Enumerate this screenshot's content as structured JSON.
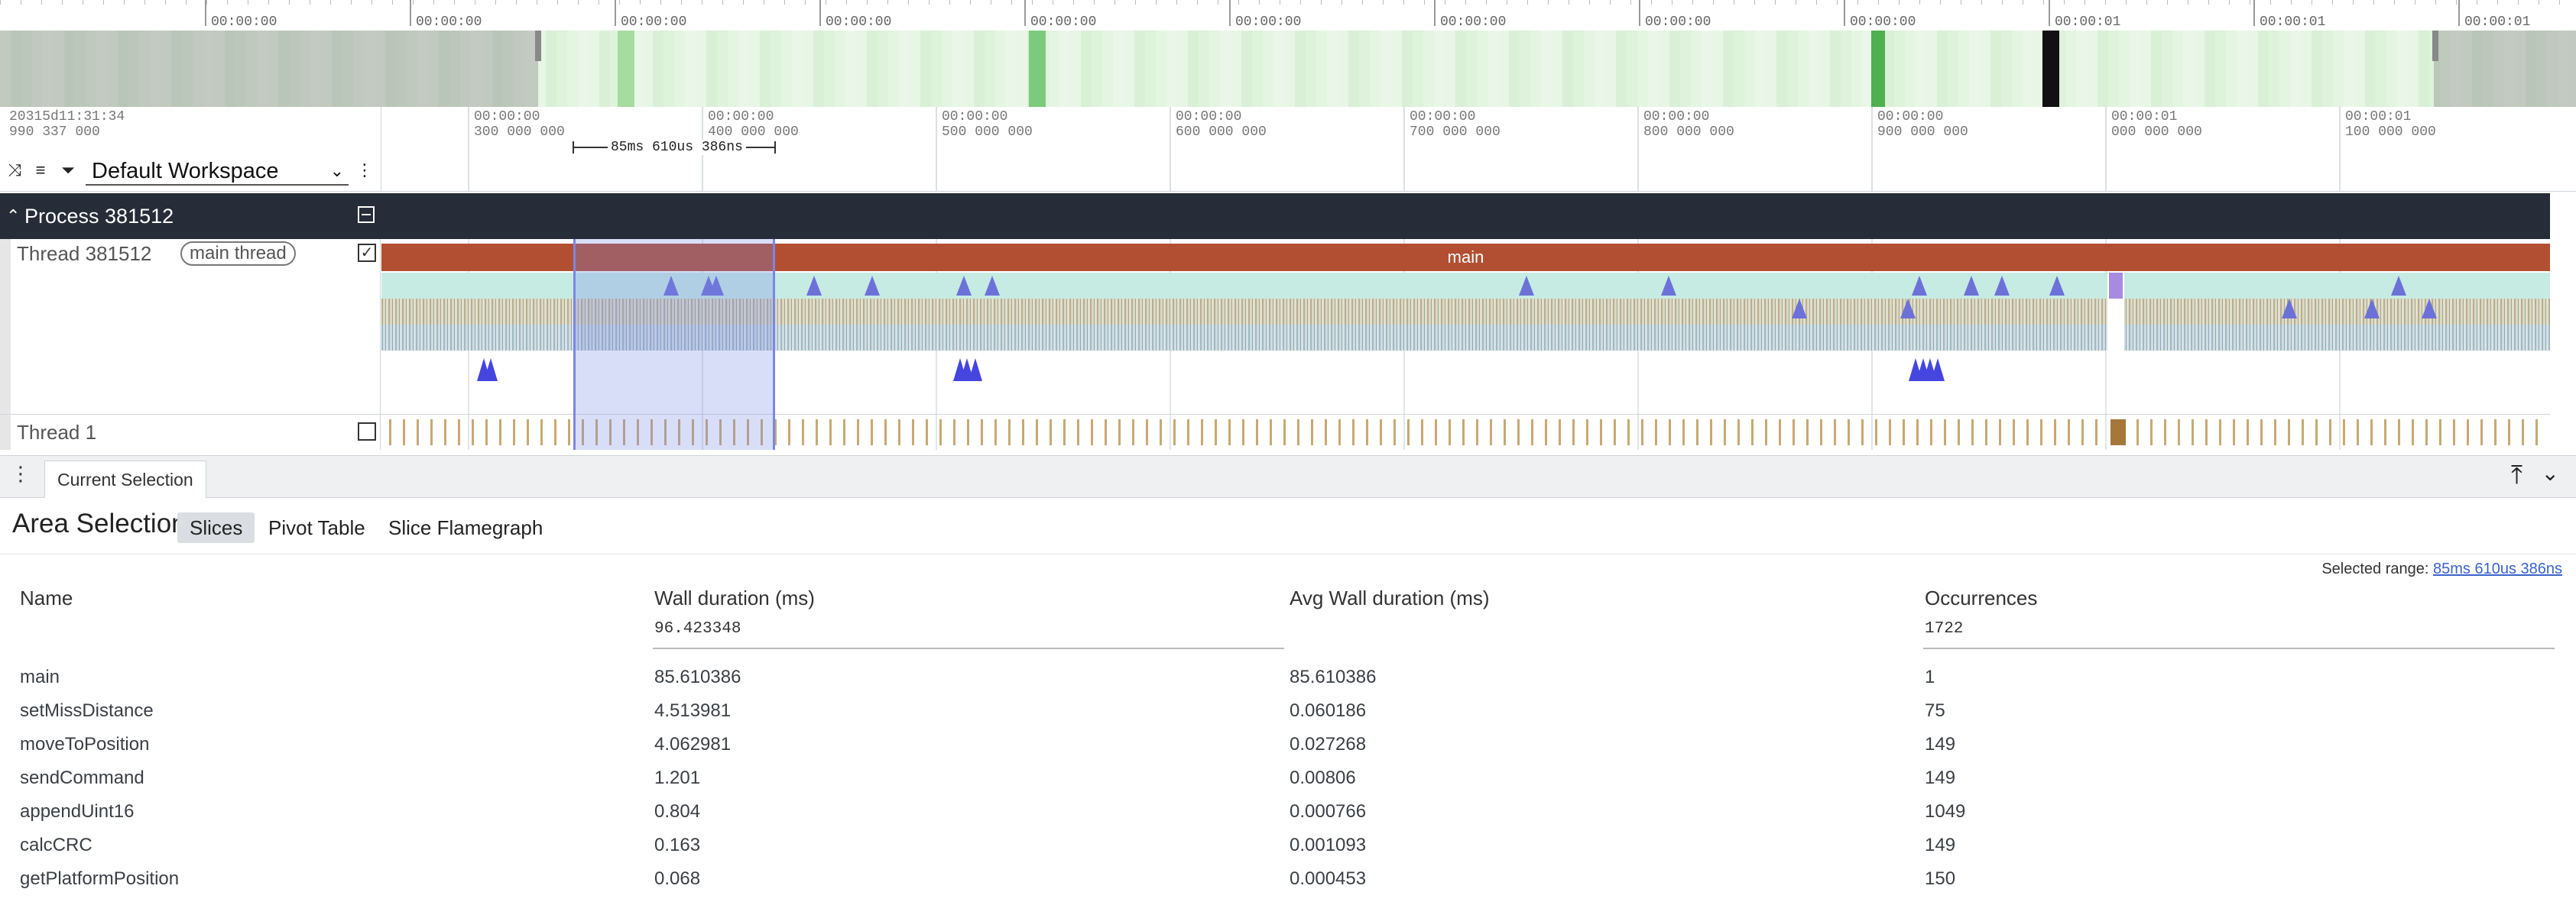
{
  "overview": {
    "tick_labels": [
      "00:00:00",
      "00:00:00",
      "00:00:00",
      "00:00:00",
      "00:00:00",
      "00:00:00",
      "00:00:00",
      "00:00:00",
      "00:00:00",
      "00:00:01",
      "00:00:01",
      "00:00:01"
    ]
  },
  "axis": {
    "origin_line1": "20315d11:31:34",
    "origin_line2": "990 337 000",
    "ticks": [
      {
        "line1": "00:00:00",
        "line2": "300 000 000"
      },
      {
        "line1": "00:00:00",
        "line2": "400 000 000"
      },
      {
        "line1": "00:00:00",
        "line2": "500 000 000"
      },
      {
        "line1": "00:00:00",
        "line2": "600 000 000"
      },
      {
        "line1": "00:00:00",
        "line2": "700 000 000"
      },
      {
        "line1": "00:00:00",
        "line2": "800 000 000"
      },
      {
        "line1": "00:00:00",
        "line2": "900 000 000"
      },
      {
        "line1": "00:00:01",
        "line2": "000 000 000"
      },
      {
        "line1": "00:00:01",
        "line2": "100 000 000"
      }
    ],
    "range_measure": "85ms 610us 386ns"
  },
  "toolbar": {
    "workspace": "Default Workspace",
    "collapse_icon": "collapse-all-icon",
    "filter_icon": "filter-icon",
    "menu_icon": "kebab-menu-icon"
  },
  "process": {
    "title": "Process 381512"
  },
  "threads": [
    {
      "name": "Thread 381512",
      "tag": "main thread",
      "checked": true,
      "slice_label": "main"
    },
    {
      "name": "Thread 1",
      "checked": false
    }
  ],
  "panel": {
    "tab_label": "Current Selection",
    "area_title": "Area Selection",
    "views": [
      "Slices",
      "Pivot Table",
      "Slice Flamegraph"
    ],
    "active_view": "Slices",
    "selected_range_label": "Selected range:",
    "selected_range_value": "85ms 610us 386ns"
  },
  "table": {
    "columns": [
      "Name",
      "Wall duration (ms)",
      "Avg Wall duration (ms)",
      "Occurrences"
    ],
    "totals": [
      "",
      "96.423348",
      "",
      "1722"
    ],
    "rows": [
      [
        "main",
        "85.610386",
        "85.610386",
        "1"
      ],
      [
        "setMissDistance",
        "4.513981",
        "0.060186",
        "75"
      ],
      [
        "moveToPosition",
        "4.062981",
        "0.027268",
        "149"
      ],
      [
        "sendCommand",
        "1.201",
        "0.00806",
        "149"
      ],
      [
        "appendUint16",
        "0.804",
        "0.000766",
        "1049"
      ],
      [
        "calcCRC",
        "0.163",
        "0.001093",
        "149"
      ],
      [
        "getPlatformPosition",
        "0.068",
        "0.000453",
        "150"
      ]
    ]
  },
  "colors": {
    "process_header": "#262c38",
    "main_slice": "#b24f32",
    "selection": "#7c86e4",
    "minimap_bg": "#e5f5e3"
  }
}
